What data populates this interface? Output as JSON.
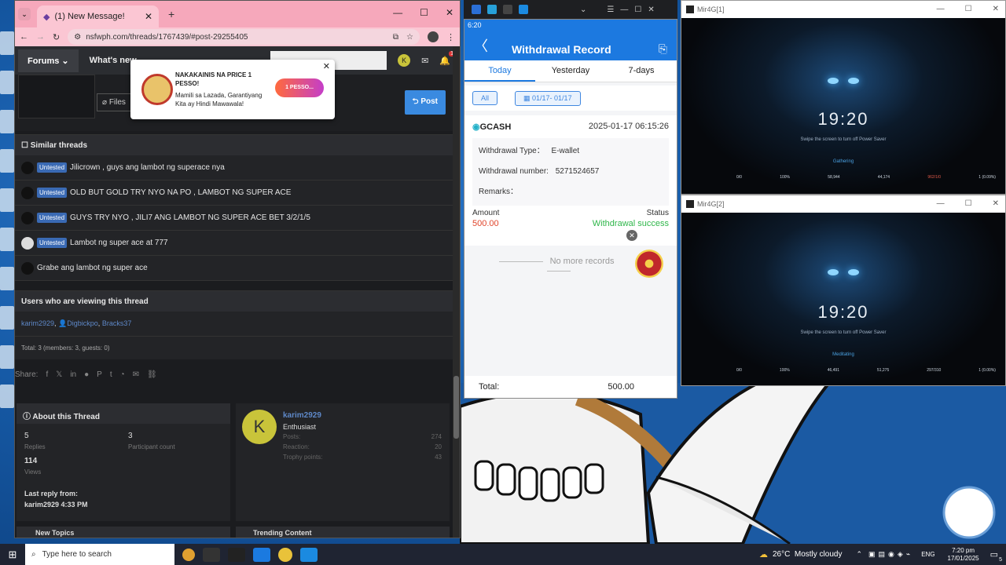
{
  "browser": {
    "tab_title": "(1) New Message!",
    "url": "nsfwph.com/threads/1767439/#post-29255405",
    "avatar_letter": "K",
    "notif_count": "1"
  },
  "forum": {
    "nav_forums": "Forums",
    "nav_whats_new": "What's new",
    "files_label": "Files",
    "post_button": "Post",
    "similar_title": "Similar threads",
    "badge": "Untested",
    "threads": [
      {
        "title": "Jilicrown , guys ang lambot ng superace nya",
        "badge": true
      },
      {
        "title": "OLD BUT GOLD TRY NYO NA PO , LAMBOT NG SUPER ACE",
        "badge": true
      },
      {
        "title": "GUYS TRY NYO , JILI7 ANG LAMBOT NG SUPER ACE BET 3/2/1/5",
        "badge": true
      },
      {
        "title": "Lambot ng super ace at 777",
        "badge": true
      },
      {
        "title": "Grabe ang lambot ng super ace",
        "badge": false
      }
    ],
    "viewing_title": "Users who are viewing this thread",
    "viewers": [
      "karim2929",
      "Digbickpo",
      "Bracks37"
    ],
    "viewing_total": "Total: 3 (members: 3, guests: 0)",
    "share_label": "Share:",
    "about_title": "About this Thread",
    "replies_val": "5",
    "replies_label": "Replies",
    "participants_val": "3",
    "participants_label": "Participant count",
    "views_val": "114",
    "views_label": "Views",
    "last_reply_label": "Last reply from:",
    "last_reply_val": "karim2929 4:33 PM",
    "user_name": "karim2929",
    "user_title": "Enthusiast",
    "posts_label": "Posts:",
    "posts_val": "274",
    "reaction_label": "Reaction:",
    "reaction_val": "20",
    "trophy_label": "Trophy points:",
    "trophy_val": "43",
    "new_topics": "New Topics",
    "trending": "Trending Content"
  },
  "popup": {
    "title": "NAKAKAINIS NA PRICE 1 PESSO!",
    "body": "Mamili sa Lazada, Garantiyang Kita ay Hindi Mawawala!",
    "cta": "1 PESSO..."
  },
  "phone": {
    "time": "6:20",
    "header": "Withdrawal Record",
    "tabs": [
      "Today",
      "Yesterday",
      "7-days"
    ],
    "filter_all": "All",
    "filter_date": "01/17- 01/17",
    "provider": "GCASH",
    "datetime": "2025-01-17 06:15:26",
    "type_label": "Withdrawal Type：",
    "type_val": "E-wallet",
    "number_label": "Withdrawal number:",
    "number_val": "5271524657",
    "remarks_label": "Remarks：",
    "amount_label": "Amount",
    "amount_val": "500.00",
    "status_label": "Status",
    "status_val": "Withdrawal success",
    "no_more": "No more records",
    "total_label": "Total:",
    "total_val": "500.00"
  },
  "game1": {
    "title": "Mir4G[1]",
    "clock": "19:20",
    "swipe": "Swipe the screen to turn off Power Saver",
    "status": "Gathering",
    "stats": [
      "0/0",
      "100%",
      "58,944",
      "44,174",
      "962/1/0",
      "1 (0.09%)"
    ]
  },
  "game2": {
    "title": "Mir4G[2]",
    "clock": "19:20",
    "swipe": "Swipe the screen to turn off Power Saver",
    "status": "Meditating",
    "stats": [
      "0/0",
      "100%",
      "46,491",
      "51,275",
      "297/310",
      "1 (0.00%)"
    ]
  },
  "taskbar": {
    "search_placeholder": "Type here to search",
    "weather": "26°C  Mostly cloudy",
    "lang": "ENG",
    "time": "7:20 pm",
    "date": "17/01/2025",
    "notif": "5"
  }
}
